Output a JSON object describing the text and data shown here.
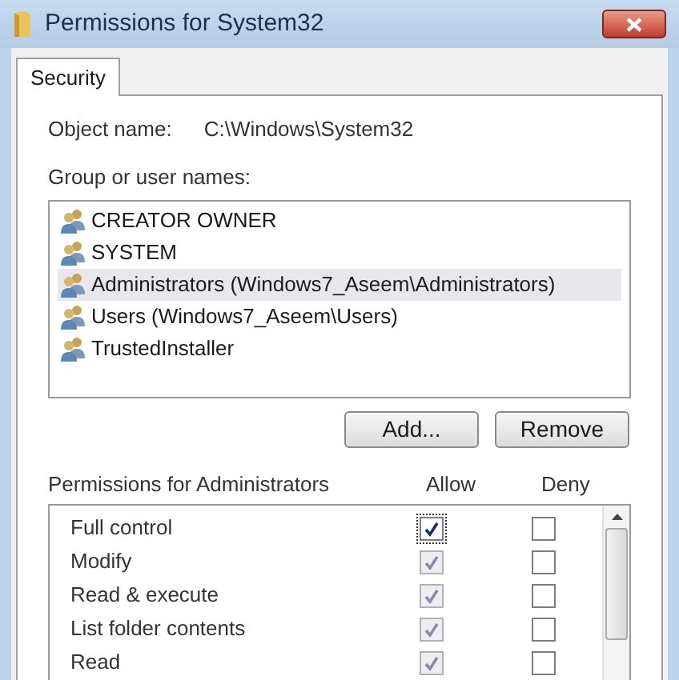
{
  "window": {
    "title": "Permissions for System32"
  },
  "tabs": [
    {
      "label": "Security",
      "selected": true
    }
  ],
  "object_name": {
    "label": "Object name:",
    "value": "C:\\Windows\\System32"
  },
  "groups": {
    "label": "Group or user names:",
    "items": [
      {
        "name": "CREATOR OWNER",
        "selected": false
      },
      {
        "name": "SYSTEM",
        "selected": false
      },
      {
        "name": "Administrators (Windows7_Aseem\\Administrators)",
        "selected": true
      },
      {
        "name": "Users (Windows7_Aseem\\Users)",
        "selected": false
      },
      {
        "name": "TrustedInstaller",
        "selected": false
      }
    ]
  },
  "buttons": [
    "Add...",
    "Remove"
  ],
  "permissions": {
    "label": "Permissions for Administrators",
    "allow_label": "Allow",
    "deny_label": "Deny",
    "rows": [
      {
        "name": "Full control",
        "allow": {
          "checked": true,
          "disabled": false
        },
        "deny": {
          "checked": false
        }
      },
      {
        "name": "Modify",
        "allow": {
          "checked": true,
          "disabled": true
        },
        "deny": {
          "checked": false
        }
      },
      {
        "name": "Read & execute",
        "allow": {
          "checked": true,
          "disabled": true
        },
        "deny": {
          "checked": false
        }
      },
      {
        "name": "List folder contents",
        "allow": {
          "checked": true,
          "disabled": true
        },
        "deny": {
          "checked": false
        }
      },
      {
        "name": "Read",
        "allow": {
          "checked": true,
          "disabled": true
        },
        "deny": {
          "checked": false
        }
      }
    ]
  }
}
